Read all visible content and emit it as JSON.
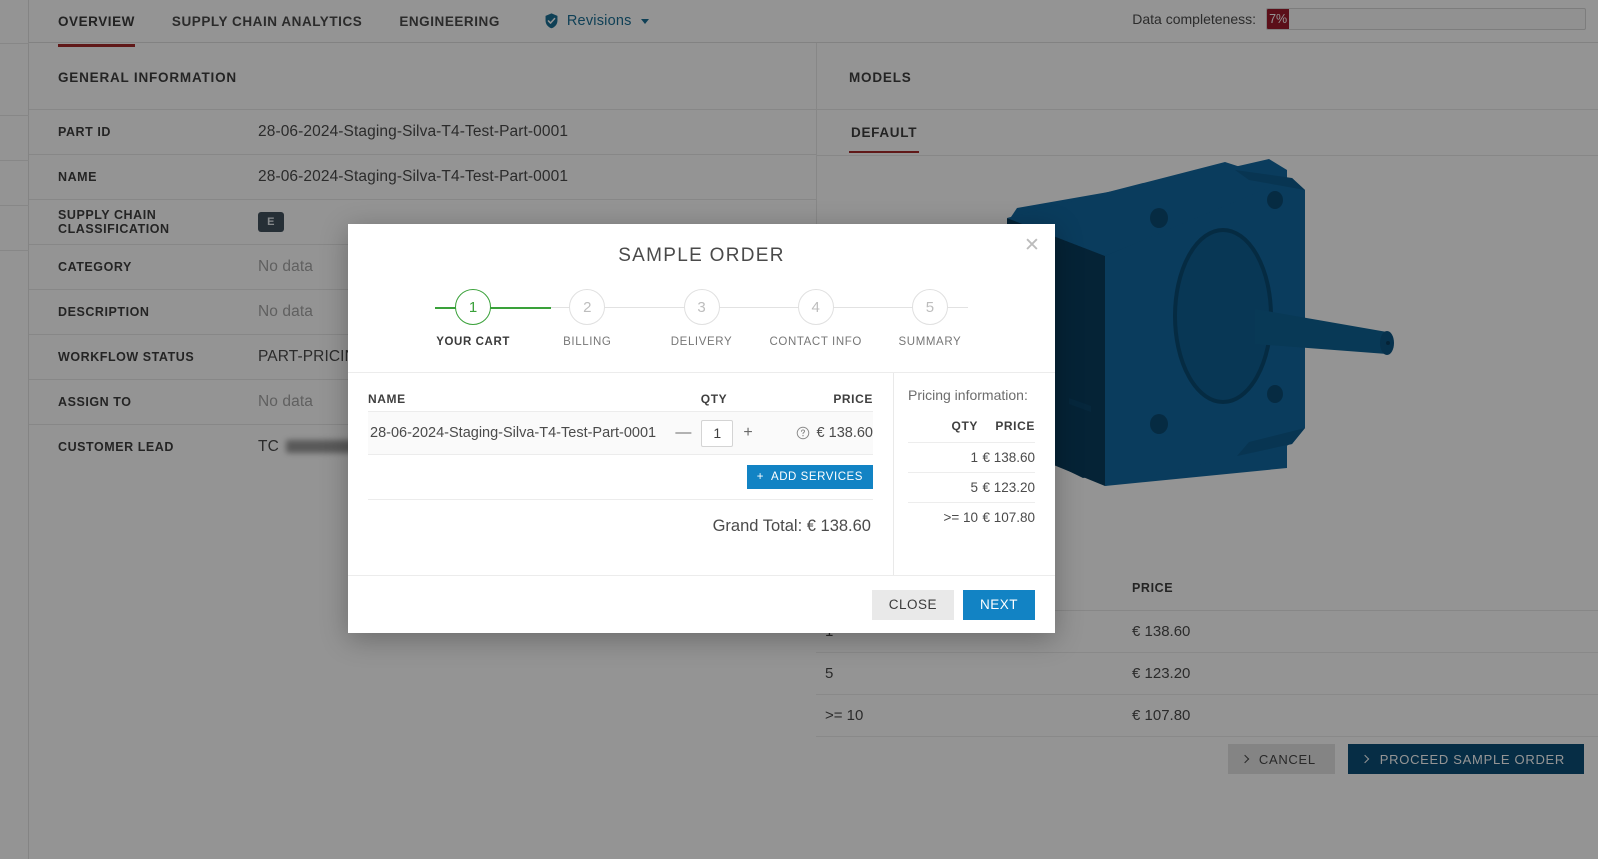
{
  "nav": {
    "tabs": [
      {
        "label": "Overview",
        "active": true
      },
      {
        "label": "Supply Chain Analytics",
        "active": false
      },
      {
        "label": "Engineering",
        "active": false
      }
    ],
    "revisions_label": "Revisions"
  },
  "completeness": {
    "label": "Data completeness:",
    "value": "7%"
  },
  "general_information": {
    "title": "General Information",
    "rows": [
      {
        "label": "Part ID",
        "value": "28-06-2024-Staging-Silva-T4-Test-Part-0001",
        "muted": false
      },
      {
        "label": "Name",
        "value": "28-06-2024-Staging-Silva-T4-Test-Part-0001",
        "muted": false
      },
      {
        "label": "Supply Chain Classification",
        "value": "E",
        "muted": false
      },
      {
        "label": "Category",
        "value": "No data",
        "muted": true
      },
      {
        "label": "Description",
        "value": "No data",
        "muted": true
      },
      {
        "label": "Workflow Status",
        "value": "PART-PRICING-",
        "muted": false
      },
      {
        "label": "Assign To",
        "value": "No data",
        "muted": true
      },
      {
        "label": "Customer Lead",
        "value": "TC",
        "muted": false
      }
    ]
  },
  "models": {
    "title": "Models",
    "tab_label": "Default",
    "model_color": "#1268a0",
    "model_shade_dark": "#0d4e78",
    "model_shade_darker": "#0a3d5e"
  },
  "background_price_table": {
    "headers": [
      "",
      "Price"
    ],
    "rows": [
      {
        "qty": "1",
        "price": "€ 138.60"
      },
      {
        "qty": "5",
        "price": "€ 123.20"
      },
      {
        "qty": ">= 10",
        "price": "€ 107.80"
      }
    ]
  },
  "bottom_actions": {
    "cancel_label": "Cancel",
    "proceed_label": "Proceed Sample Order"
  },
  "modal": {
    "title": "Sample Order",
    "close_icon": "close-icon",
    "steps": [
      {
        "number": "1",
        "label": "Your Cart",
        "active": true
      },
      {
        "number": "2",
        "label": "Billing",
        "active": false
      },
      {
        "number": "3",
        "label": "Delivery",
        "active": false
      },
      {
        "number": "4",
        "label": "Contact Info",
        "active": false
      },
      {
        "number": "5",
        "label": "Summary",
        "active": false
      }
    ],
    "cart": {
      "headers": {
        "name": "Name",
        "qty": "Qty",
        "price": "Price"
      },
      "item_name": "28-06-2024-Staging-Silva-T4-Test-Part-0001",
      "qty_value": "1",
      "decrement_label": "—",
      "increment_label": "+",
      "item_price": "€ 138.60",
      "add_services_label": "Add Services",
      "add_services_plus": "+",
      "grand_total": "Grand Total: € 138.60"
    },
    "pricing": {
      "title": "Pricing information:",
      "headers": {
        "qty": "Qty",
        "price": "Price"
      },
      "rows": [
        {
          "qty": "1",
          "price": "€ 138.60"
        },
        {
          "qty": "5",
          "price": "€ 123.20"
        },
        {
          "qty": ">= 10",
          "price": "€ 107.80"
        }
      ]
    },
    "footer": {
      "close_label": "Close",
      "next_label": "Next"
    }
  },
  "colors": {
    "accent_red": "#a52a2a",
    "accent_blue": "#1283c4",
    "dark_blue": "#0c4f78",
    "green": "#3aa13a",
    "completeness_red": "#9e1b2b"
  }
}
